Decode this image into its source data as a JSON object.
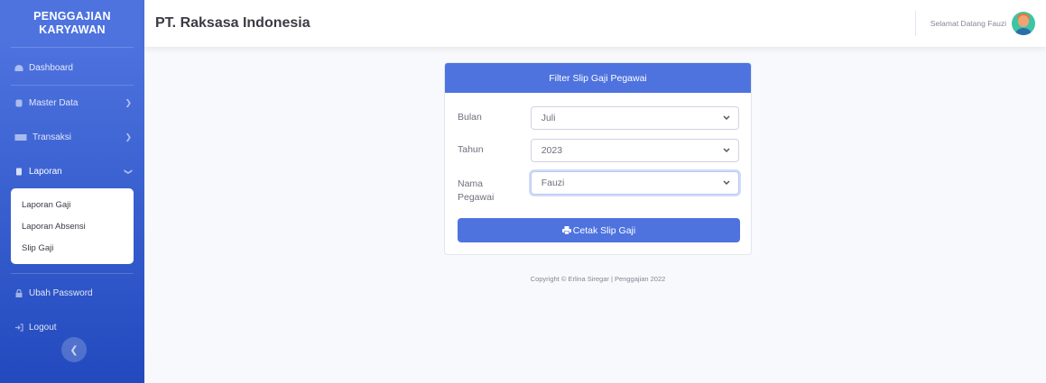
{
  "sidebar": {
    "brand_line1": "PENGGAJIAN",
    "brand_line2": "KARYAWAN",
    "items": [
      {
        "label": "Dashboard",
        "icon": "dashboard-icon"
      },
      {
        "label": "Master Data",
        "icon": "database-icon"
      },
      {
        "label": "Transaksi",
        "icon": "money-icon"
      },
      {
        "label": "Laporan",
        "icon": "copy-icon"
      }
    ],
    "laporan_sub": [
      "Laporan Gaji",
      "Laporan Absensi",
      "Slip Gaji"
    ],
    "bottom_items": [
      {
        "label": "Ubah Password",
        "icon": "lock-icon"
      },
      {
        "label": "Logout",
        "icon": "logout-icon"
      }
    ],
    "toggle_icon": "chevron-left-icon"
  },
  "topbar": {
    "company": "PT. Raksasa Indonesia",
    "greeting": "Selamat Datang Fauzi"
  },
  "card": {
    "title": "Filter Slip Gaji Pegawai",
    "fields": {
      "bulan_label": "Bulan",
      "bulan_value": "Juli",
      "tahun_label": "Tahun",
      "tahun_value": "2023",
      "nama_label_line1": "Nama",
      "nama_label_line2": "Pegawai",
      "nama_value": "Fauzi"
    },
    "button": "Cetak Slip Gaji"
  },
  "footer": {
    "text": "Copyright © Erlina Siregar | Penggajian 2022"
  },
  "colors": {
    "primary": "#4e73df",
    "sidebar_dark": "#224abe",
    "background": "#f8f9fc"
  }
}
